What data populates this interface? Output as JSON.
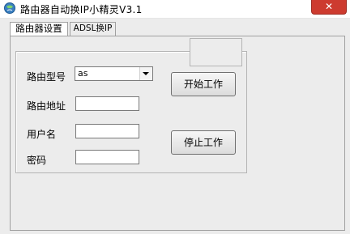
{
  "window": {
    "title": "路由器自动换IP小精灵V3.1",
    "close_symbol": "✕"
  },
  "tabs": [
    {
      "label": "路由器设置"
    },
    {
      "label": "ADSL换IP"
    }
  ],
  "form": {
    "router_model_label": "路由型号",
    "router_model_value": "as",
    "router_address_label": "路由地址",
    "router_address_value": "",
    "username_label": "用户名",
    "username_value": "",
    "password_label": "密码",
    "password_value": ""
  },
  "buttons": {
    "start_label": "开始工作",
    "stop_label": "停止工作"
  }
}
